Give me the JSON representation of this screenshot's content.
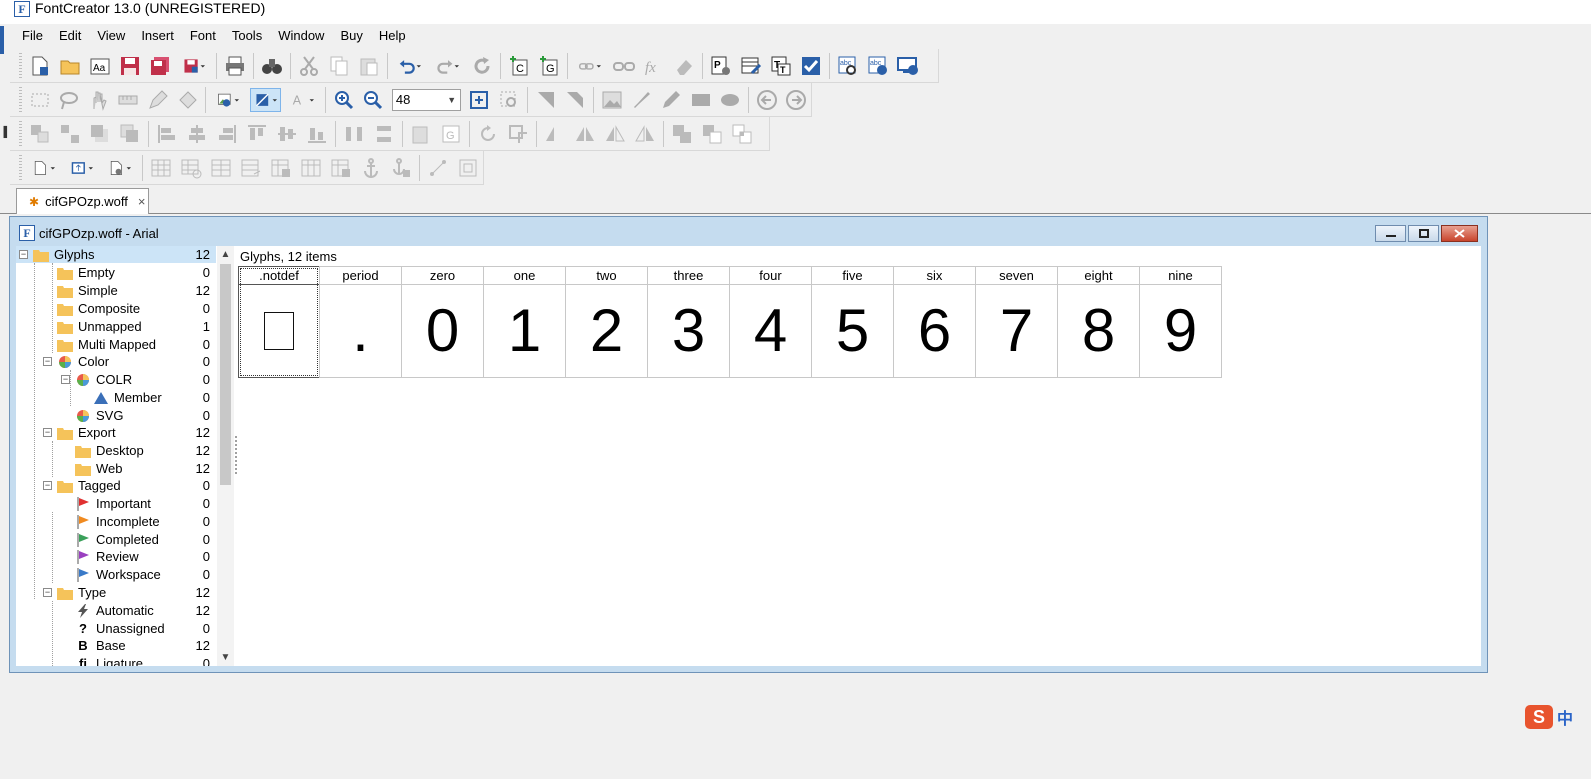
{
  "app": {
    "title": "FontCreator 13.0 (UNREGISTERED)",
    "icon_letter": "F"
  },
  "menu": [
    "File",
    "Edit",
    "View",
    "Insert",
    "Font",
    "Tools",
    "Window",
    "Buy",
    "Help"
  ],
  "toolbar": {
    "zoom_value": "48"
  },
  "document_tab": {
    "label": "cifGPOzp.woff",
    "close_glyph": "×"
  },
  "font_window": {
    "caption": "cifGPOzp.woff - Arial",
    "icon_letter": "F"
  },
  "tree": [
    {
      "label": "Glyphs",
      "count": "12",
      "icon": "folder-icon",
      "selected": true
    },
    {
      "label": "Empty",
      "count": "0",
      "icon": "folder-icon"
    },
    {
      "label": "Simple",
      "count": "12",
      "icon": "folder-icon"
    },
    {
      "label": "Composite",
      "count": "0",
      "icon": "folder-icon"
    },
    {
      "label": "Unmapped",
      "count": "1",
      "icon": "folder-icon"
    },
    {
      "label": "Multi Mapped",
      "count": "0",
      "icon": "folder-icon"
    },
    {
      "label": "Color",
      "count": "0",
      "icon": "color-wheel-icon"
    },
    {
      "label": "COLR",
      "count": "0",
      "icon": "color-wheel-icon"
    },
    {
      "label": "Member",
      "count": "0",
      "icon": "triangle-icon"
    },
    {
      "label": "SVG",
      "count": "0",
      "icon": "color-wheel-icon"
    },
    {
      "label": "Export",
      "count": "12",
      "icon": "folder-icon"
    },
    {
      "label": "Desktop",
      "count": "12",
      "icon": "folder-icon"
    },
    {
      "label": "Web",
      "count": "12",
      "icon": "folder-icon"
    },
    {
      "label": "Tagged",
      "count": "0",
      "icon": "folder-icon"
    },
    {
      "label": "Important",
      "count": "0",
      "icon": "red-flag-icon"
    },
    {
      "label": "Incomplete",
      "count": "0",
      "icon": "orange-flag-icon"
    },
    {
      "label": "Completed",
      "count": "0",
      "icon": "green-flag-icon"
    },
    {
      "label": "Review",
      "count": "0",
      "icon": "purple-flag-icon"
    },
    {
      "label": "Workspace",
      "count": "0",
      "icon": "blue-flag-icon"
    },
    {
      "label": "Type",
      "count": "12",
      "icon": "folder-icon"
    },
    {
      "label": "Automatic",
      "count": "12",
      "icon": "lightning-icon"
    },
    {
      "label": "Unassigned",
      "count": "0",
      "icon_text": "?"
    },
    {
      "label": "Base",
      "count": "12",
      "icon_text": "B"
    },
    {
      "label": "Ligature",
      "count": "0",
      "icon_text": "fi"
    }
  ],
  "overview": {
    "header": "Glyphs, 12 items",
    "glyphs": [
      {
        "name": ".notdef",
        "char": ""
      },
      {
        "name": "period",
        "char": "."
      },
      {
        "name": "zero",
        "char": "0"
      },
      {
        "name": "one",
        "char": "1"
      },
      {
        "name": "two",
        "char": "2"
      },
      {
        "name": "three",
        "char": "3"
      },
      {
        "name": "four",
        "char": "4"
      },
      {
        "name": "five",
        "char": "5"
      },
      {
        "name": "six",
        "char": "6"
      },
      {
        "name": "seven",
        "char": "7"
      },
      {
        "name": "eight",
        "char": "8"
      },
      {
        "name": "nine",
        "char": "9"
      }
    ]
  },
  "ime": {
    "logo": "S",
    "lang": "中"
  },
  "colors": {
    "selection": "#cce4f7",
    "window_frame": "#c5dcef",
    "folder": "#f5c35a",
    "accent": "#2a5fa8"
  }
}
